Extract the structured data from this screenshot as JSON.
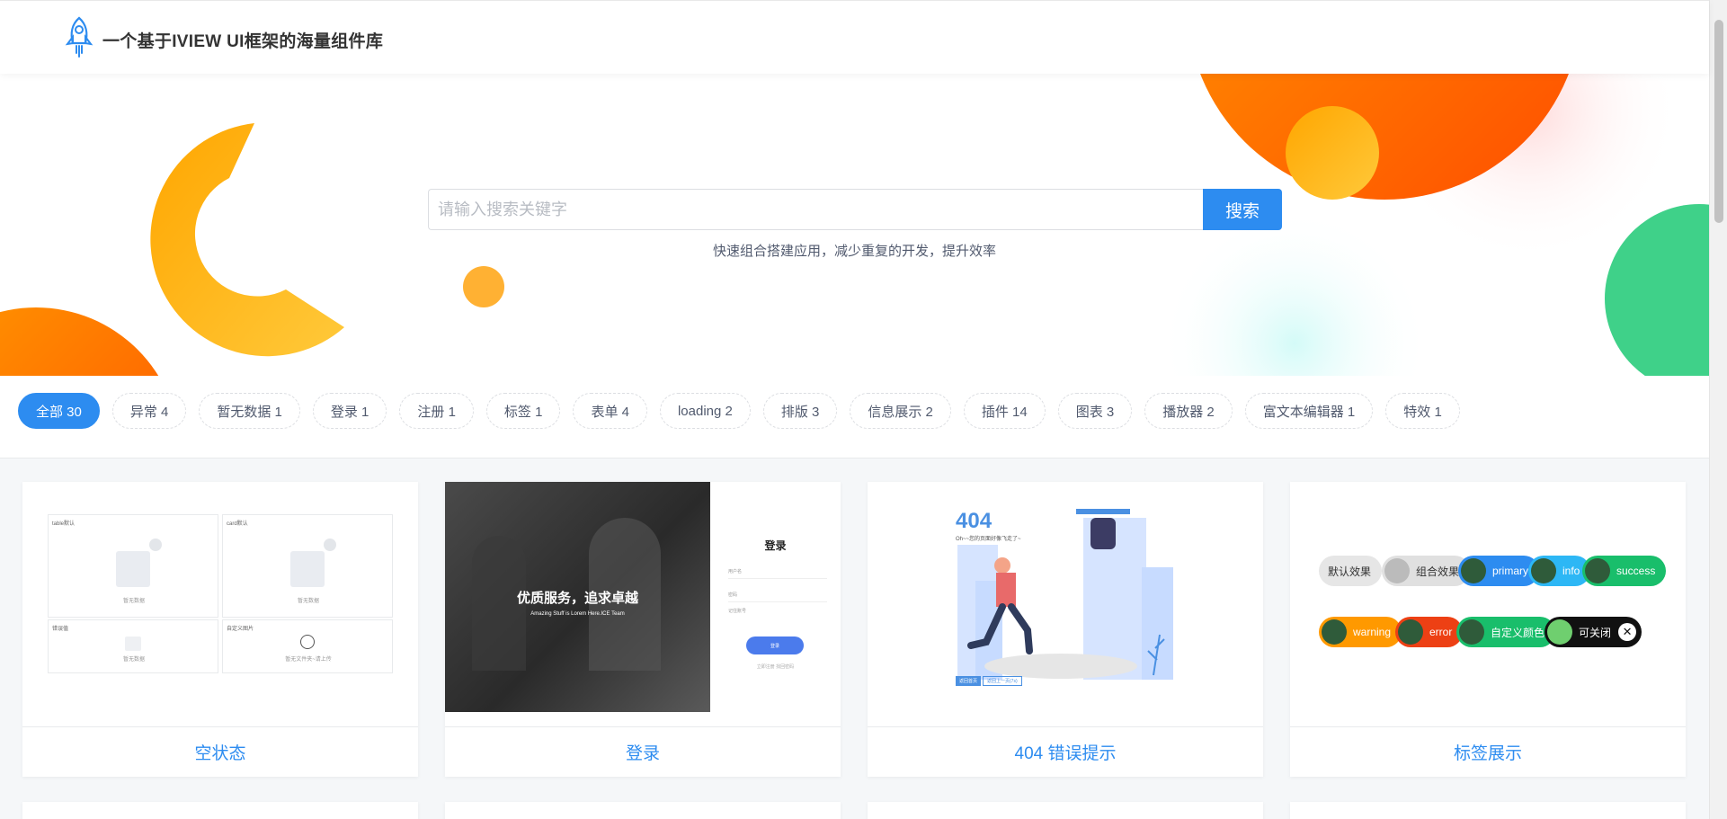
{
  "header": {
    "title": "一个基于IVIEW UI框架的海量组件库",
    "logo_icon": "rocket-icon"
  },
  "search": {
    "placeholder": "请输入搜索关键字",
    "value": "",
    "button_label": "搜索",
    "slogan": "快速组合搭建应用，减少重复的开发，提升效率"
  },
  "filters": [
    {
      "label": "全部 30",
      "active": true
    },
    {
      "label": "异常 4"
    },
    {
      "label": "暂无数据 1"
    },
    {
      "label": "登录 1"
    },
    {
      "label": "注册 1"
    },
    {
      "label": "标签 1"
    },
    {
      "label": "表单 4"
    },
    {
      "label": "loading 2"
    },
    {
      "label": "排版 3"
    },
    {
      "label": "信息展示 2"
    },
    {
      "label": "插件 14"
    },
    {
      "label": "图表 3"
    },
    {
      "label": "播放器 2"
    },
    {
      "label": "富文本编辑器 1"
    },
    {
      "label": "特效 1"
    }
  ],
  "cards": [
    {
      "title": "空状态",
      "preview": {
        "panels": [
          "table默认",
          "card默认",
          "错误值",
          "自定义图片"
        ],
        "empty_text": "暂无数据",
        "custom_text": "暂无文件夹~请上传"
      }
    },
    {
      "title": "登录",
      "preview": {
        "heading": "登录",
        "slogan": "优质服务，追求卓越",
        "sub": "Amazing Stuff is Lorem Here.ICE Team",
        "username": "用户名",
        "password": "密码",
        "remember": "记住账号",
        "button": "登录",
        "links": "立即注册    找回密码"
      }
    },
    {
      "title": "404 错误提示",
      "preview": {
        "code": "404",
        "message": "Oh~~您的页面好像飞走了~",
        "btn1": "返回首页",
        "btn2": "返回上一页(7s)"
      }
    },
    {
      "title": "标签展示",
      "preview": {
        "chips": [
          "默认效果",
          "组合效果",
          "primary",
          "info",
          "success",
          "warning",
          "error",
          "自定义颜色",
          "可关闭"
        ]
      }
    }
  ],
  "colors": {
    "primary": "#2d8cf0",
    "orange": "#ff7a00",
    "yellow": "#ffb300",
    "green": "#3fd189"
  }
}
